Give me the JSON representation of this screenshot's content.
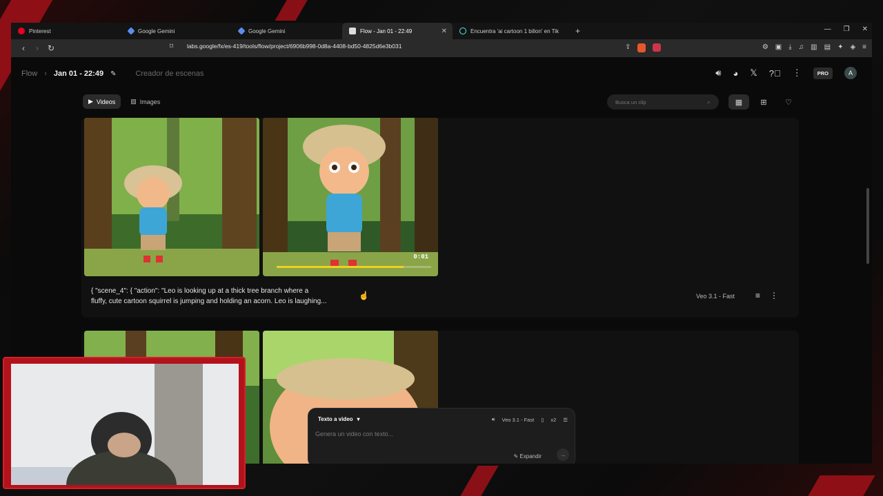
{
  "browser": {
    "tabs": [
      {
        "title": "Pinterest",
        "icon": "pinterest-icon",
        "active": false
      },
      {
        "title": "Google Gemini",
        "icon": "gemini-icon",
        "active": false
      },
      {
        "title": "Google Gemini",
        "icon": "gemini-icon",
        "active": false
      },
      {
        "title": "Flow - Jan 01 - 22:49",
        "icon": "flow-icon",
        "active": true
      },
      {
        "title": "Encuentra 'ai cartoon 1 bilion' en Tik",
        "icon": "tiktok-icon",
        "active": false
      }
    ],
    "url": "labs.google/fx/es-419/tools/flow/project/6906b998-0d8a-4408-bd50-4825d6e3b031"
  },
  "header": {
    "app_name": "Flow",
    "project": "Jan 01 - 22:49",
    "section": "Creador de escenas",
    "pro_label": "PRO",
    "avatar_letter": "A"
  },
  "filters": {
    "videos_label": "Videos",
    "images_label": "Images",
    "search_placeholder": "Busca un clip"
  },
  "clips": [
    {
      "caption_line1": "{ \"scene_4\": { \"action\": \"Leo is looking up at a thick tree branch where a",
      "caption_line2": "fluffy, cute cartoon squirrel is jumping and holding an acorn. Leo is laughing...",
      "model": "Veo 3.1 - Fast",
      "timecode": "0:01",
      "progress": 0.82
    }
  ],
  "prompt": {
    "mode": "Texto a video",
    "model": "Veo 3.1 - Fast",
    "count": "x2",
    "placeholder": "Genera un video con texto...",
    "expand_label": "Expandir"
  },
  "colors": {
    "accent_yellow": "#f1d01e",
    "stream_red": "#b3121b"
  }
}
